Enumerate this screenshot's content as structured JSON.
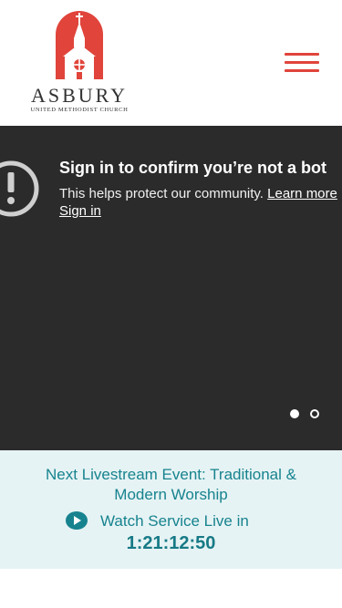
{
  "header": {
    "logo_name": "ASBURY",
    "logo_subtitle": "UNITED METHODIST CHURCH",
    "menu_icon": "hamburger-menu-icon"
  },
  "video": {
    "icon": "alert-circle-icon",
    "title": "Sign in to confirm you’re not a bot",
    "message": "This helps protect our community. ",
    "learn_more": "Learn more",
    "sign_in": "Sign in",
    "slides": 2,
    "active_slide": 1
  },
  "livestream": {
    "title": "Next Livestream Event: Traditional & Modern Worship",
    "watch_label": "Watch Service Live in",
    "countdown": "1:21:12:50",
    "icon": "play-icon"
  },
  "colors": {
    "brand_red": "#e0443b",
    "teal": "#17838f",
    "banner_bg": "#e6f3f4",
    "video_bg": "#2b2b2b"
  }
}
